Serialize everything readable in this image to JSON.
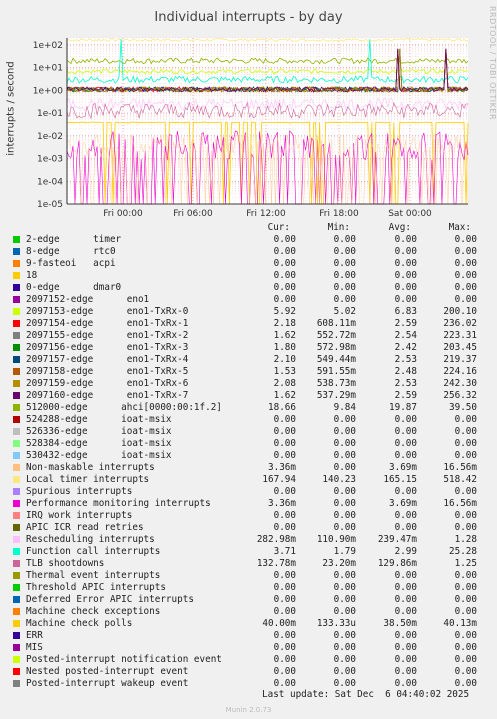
{
  "chart_data": {
    "type": "line",
    "title": "Individual interrupts - by day",
    "ylabel": "interrupts / second",
    "yscale": "log",
    "ylim": [
      1e-05,
      200
    ],
    "y_ticks": [
      "1e+02",
      "1e+01",
      "1e+00",
      "1e-01",
      "1e-02",
      "1e-03",
      "1e-04",
      "1e-05"
    ],
    "x_ticks": [
      "Fri 00:00",
      "Fri 06:00",
      "Fri 12:00",
      "Fri 18:00",
      "Sat 00:00"
    ],
    "grid": true,
    "side_text": "RRDTOOL / TOBI OETIKER",
    "columns": [
      "Cur:",
      "Min:",
      "Avg:",
      "Max:"
    ],
    "series": [
      {
        "name": "2-edge      timer",
        "color": "#00cc00",
        "cur": "0.00",
        "min": "0.00",
        "avg": "0.00",
        "max": "0.00"
      },
      {
        "name": "8-edge      rtc0",
        "color": "#0066b3",
        "cur": "0.00",
        "min": "0.00",
        "avg": "0.00",
        "max": "0.00"
      },
      {
        "name": "9-fasteoi   acpi",
        "color": "#ff8000",
        "cur": "0.00",
        "min": "0.00",
        "avg": "0.00",
        "max": "0.00"
      },
      {
        "name": "18",
        "color": "#ffcc00",
        "cur": "0.00",
        "min": "0.00",
        "avg": "0.00",
        "max": "0.00"
      },
      {
        "name": "0-edge      dmar0",
        "color": "#330099",
        "cur": "0.00",
        "min": "0.00",
        "avg": "0.00",
        "max": "0.00"
      },
      {
        "name": "2097152-edge      eno1",
        "color": "#990099",
        "cur": "0.00",
        "min": "0.00",
        "avg": "0.00",
        "max": "0.00"
      },
      {
        "name": "2097153-edge      eno1-TxRx-0",
        "color": "#ccff00",
        "cur": "5.92",
        "min": "5.02",
        "avg": "6.83",
        "max": "200.10"
      },
      {
        "name": "2097154-edge      eno1-TxRx-1",
        "color": "#ff0000",
        "cur": "2.18",
        "min": "608.11m",
        "avg": "2.59",
        "max": "236.02"
      },
      {
        "name": "2097155-edge      eno1-TxRx-2",
        "color": "#808080",
        "cur": "1.62",
        "min": "552.72m",
        "avg": "2.54",
        "max": "223.31"
      },
      {
        "name": "2097156-edge      eno1-TxRx-3",
        "color": "#008f00",
        "cur": "1.80",
        "min": "572.98m",
        "avg": "2.42",
        "max": "203.45"
      },
      {
        "name": "2097157-edge      eno1-TxRx-4",
        "color": "#00487d",
        "cur": "2.10",
        "min": "549.44m",
        "avg": "2.53",
        "max": "219.37"
      },
      {
        "name": "2097158-edge      eno1-TxRx-5",
        "color": "#b35a00",
        "cur": "1.53",
        "min": "591.55m",
        "avg": "2.48",
        "max": "224.16"
      },
      {
        "name": "2097159-edge      eno1-TxRx-6",
        "color": "#b38f00",
        "cur": "2.08",
        "min": "538.73m",
        "avg": "2.53",
        "max": "242.30"
      },
      {
        "name": "2097160-edge      eno1-TxRx-7",
        "color": "#6b006b",
        "cur": "1.62",
        "min": "537.29m",
        "avg": "2.59",
        "max": "256.32"
      },
      {
        "name": "512000-edge      ahci[0000:00:1f.2]",
        "color": "#8fb300",
        "cur": "18.66",
        "min": "9.84",
        "avg": "19.87",
        "max": "39.50"
      },
      {
        "name": "524288-edge      ioat-msix",
        "color": "#b30000",
        "cur": "0.00",
        "min": "0.00",
        "avg": "0.00",
        "max": "0.00"
      },
      {
        "name": "526336-edge      ioat-msix",
        "color": "#bebebe",
        "cur": "0.00",
        "min": "0.00",
        "avg": "0.00",
        "max": "0.00"
      },
      {
        "name": "528384-edge      ioat-msix",
        "color": "#80ff80",
        "cur": "0.00",
        "min": "0.00",
        "avg": "0.00",
        "max": "0.00"
      },
      {
        "name": "530432-edge      ioat-msix",
        "color": "#80c9ff",
        "cur": "0.00",
        "min": "0.00",
        "avg": "0.00",
        "max": "0.00"
      },
      {
        "name": "Non-maskable interrupts",
        "color": "#ffc080",
        "cur": "3.36m",
        "min": "0.00",
        "avg": "3.69m",
        "max": "16.56m"
      },
      {
        "name": "Local timer interrupts",
        "color": "#ffe680",
        "cur": "167.94",
        "min": "140.23",
        "avg": "165.15",
        "max": "518.42"
      },
      {
        "name": "Spurious interrupts",
        "color": "#aa80ff",
        "cur": "0.00",
        "min": "0.00",
        "avg": "0.00",
        "max": "0.00"
      },
      {
        "name": "Performance monitoring interrupts",
        "color": "#ee00cc",
        "cur": "3.36m",
        "min": "0.00",
        "avg": "3.69m",
        "max": "16.56m"
      },
      {
        "name": "IRQ work interrupts",
        "color": "#ff8080",
        "cur": "0.00",
        "min": "0.00",
        "avg": "0.00",
        "max": "0.00"
      },
      {
        "name": "APIC ICR read retries",
        "color": "#666600",
        "cur": "0.00",
        "min": "0.00",
        "avg": "0.00",
        "max": "0.00"
      },
      {
        "name": "Rescheduling interrupts",
        "color": "#ffbfff",
        "cur": "282.98m",
        "min": "110.90m",
        "avg": "239.47m",
        "max": "1.28"
      },
      {
        "name": "Function call interrupts",
        "color": "#00ffcc",
        "cur": "3.71",
        "min": "1.79",
        "avg": "2.99",
        "max": "25.28"
      },
      {
        "name": "TLB shootdowns",
        "color": "#cc6699",
        "cur": "132.78m",
        "min": "23.20m",
        "avg": "129.86m",
        "max": "1.25"
      },
      {
        "name": "Thermal event interrupts",
        "color": "#999900",
        "cur": "0.00",
        "min": "0.00",
        "avg": "0.00",
        "max": "0.00"
      },
      {
        "name": "Threshold APIC interrupts",
        "color": "#00cc00",
        "cur": "0.00",
        "min": "0.00",
        "avg": "0.00",
        "max": "0.00"
      },
      {
        "name": "Deferred Error APIC interrupts",
        "color": "#0066b3",
        "cur": "0.00",
        "min": "0.00",
        "avg": "0.00",
        "max": "0.00"
      },
      {
        "name": "Machine check exceptions",
        "color": "#ff8000",
        "cur": "0.00",
        "min": "0.00",
        "avg": "0.00",
        "max": "0.00"
      },
      {
        "name": "Machine check polls",
        "color": "#ffcc00",
        "cur": "40.00m",
        "min": "133.33u",
        "avg": "38.50m",
        "max": "40.13m"
      },
      {
        "name": "ERR",
        "color": "#330099",
        "cur": "0.00",
        "min": "0.00",
        "avg": "0.00",
        "max": "0.00"
      },
      {
        "name": "MIS",
        "color": "#990099",
        "cur": "0.00",
        "min": "0.00",
        "avg": "0.00",
        "max": "0.00"
      },
      {
        "name": "Posted-interrupt notification event",
        "color": "#ccff00",
        "cur": "0.00",
        "min": "0.00",
        "avg": "0.00",
        "max": "0.00"
      },
      {
        "name": "Nested posted-interrupt event",
        "color": "#ff0000",
        "cur": "0.00",
        "min": "0.00",
        "avg": "0.00",
        "max": "0.00"
      },
      {
        "name": "Posted-interrupt wakeup event",
        "color": "#808080",
        "cur": "0.00",
        "min": "0.00",
        "avg": "0.00",
        "max": "0.00"
      }
    ]
  },
  "last_update": "Last update: Sat Dec  6 04:40:02 2025",
  "footer": "Munin 2.0.73"
}
